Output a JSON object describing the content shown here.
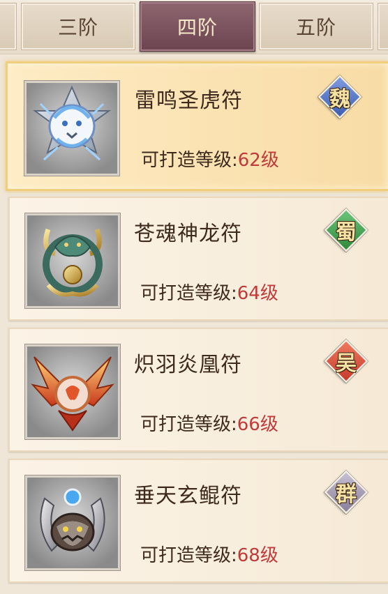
{
  "tabs": [
    {
      "label": "三阶"
    },
    {
      "label": "四阶"
    },
    {
      "label": "五阶"
    }
  ],
  "level_label": "可打造等级:",
  "items": [
    {
      "name": "雷鸣圣虎符",
      "level": "62级",
      "faction": "魏",
      "faction_color": "#3d5fb0",
      "icon": "white-tiger-emblem-icon",
      "selected": true
    },
    {
      "name": "苍魂神龙符",
      "level": "64级",
      "faction": "蜀",
      "faction_color": "#2f8a3c",
      "icon": "azure-dragon-emblem-icon",
      "selected": false
    },
    {
      "name": "炽羽炎凰符",
      "level": "66级",
      "faction": "吴",
      "faction_color": "#c63a2c",
      "icon": "vermilion-phoenix-emblem-icon",
      "selected": false
    },
    {
      "name": "垂天玄鲲符",
      "level": "68级",
      "faction": "群",
      "faction_color": "#8a7f9a",
      "icon": "black-kun-emblem-icon",
      "selected": false
    }
  ]
}
